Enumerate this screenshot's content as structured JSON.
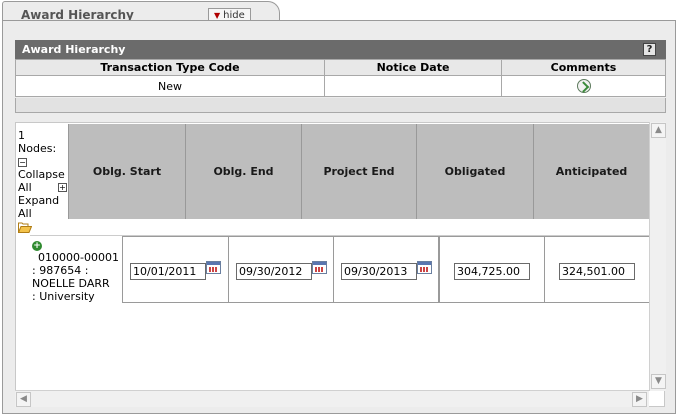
{
  "tab": {
    "title": "Award Hierarchy",
    "hide_label": "hide"
  },
  "award_hierarchy": {
    "title": "Award Hierarchy",
    "help_icon": "?",
    "columns": [
      "Transaction Type Code",
      "Notice Date",
      "Comments"
    ],
    "row": {
      "transaction_type_code": "New",
      "notice_date": ""
    }
  },
  "tree": {
    "nodes_line1": "1",
    "nodes_line2": "Nodes:",
    "collapse_all": "Collapse All",
    "expand_all": "Expand All",
    "columns": [
      "Oblg. Start",
      "Oblg. End",
      "Project End",
      "Obligated",
      "Anticipated"
    ],
    "node": {
      "label_line1": "010000-00001",
      "label_line2": ": 987654 :",
      "label_line3": "NOELLE DARR",
      "label_line4": ": University",
      "oblg_start": "10/01/2011",
      "oblg_end": "09/30/2012",
      "project_end": "09/30/2013",
      "obligated": "304,725.00",
      "anticipated": "324,501.00"
    }
  }
}
